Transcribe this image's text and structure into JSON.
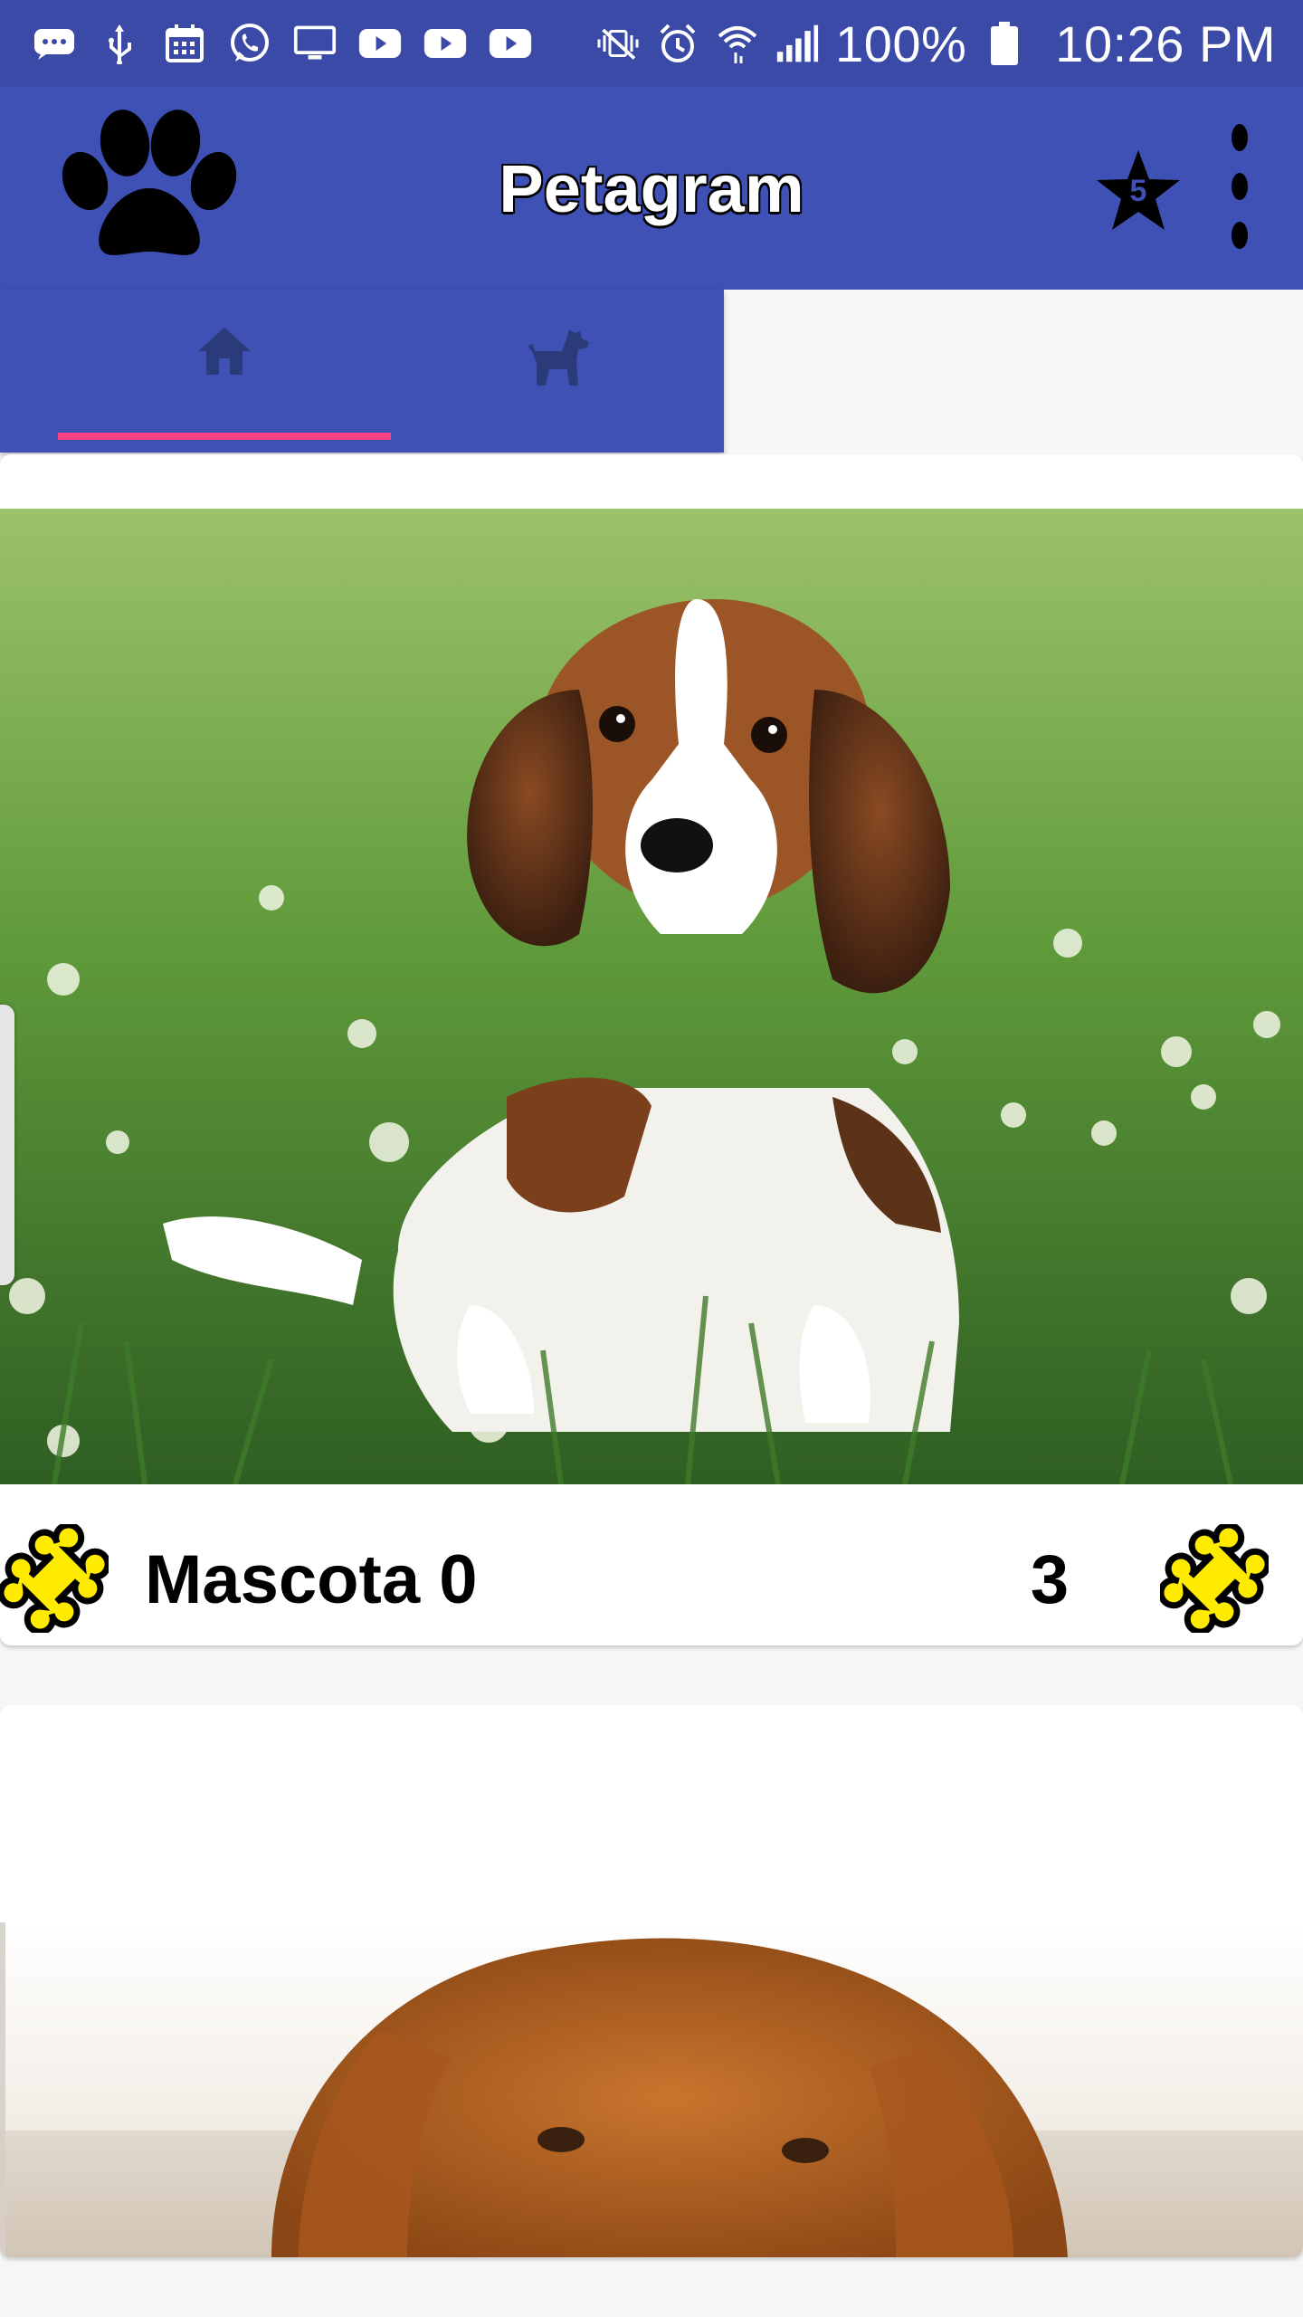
{
  "status_bar": {
    "battery": "100%",
    "time": "10:26 PM",
    "icons": [
      "messages-icon",
      "usb-icon",
      "calendar-icon",
      "whatsapp-icon",
      "cast-icon",
      "youtube-icon",
      "youtube-icon",
      "youtube-icon",
      "vibrate-mute-icon",
      "alarm-icon",
      "wifi-icon",
      "signal-icon",
      "battery-icon"
    ]
  },
  "app_bar": {
    "title": "Petagram",
    "favorites_count": "5",
    "logo_icon": "paw-icon",
    "favorites_icon": "star-icon",
    "menu_icon": "more-vert-icon",
    "color": "#3f51b5"
  },
  "tabs": [
    {
      "icon": "home-icon",
      "selected": true
    },
    {
      "icon": "dog-icon",
      "selected": false
    }
  ],
  "tab_indicator_color": "#ff4081",
  "pets": [
    {
      "name": "Mascota 0",
      "rating": "3",
      "image": "beagle puppy photo",
      "rate_icon": "bone-icon",
      "count_icon": "bone-icon"
    },
    {
      "name": "",
      "rating": "",
      "image": "golden retriever photo"
    }
  ]
}
